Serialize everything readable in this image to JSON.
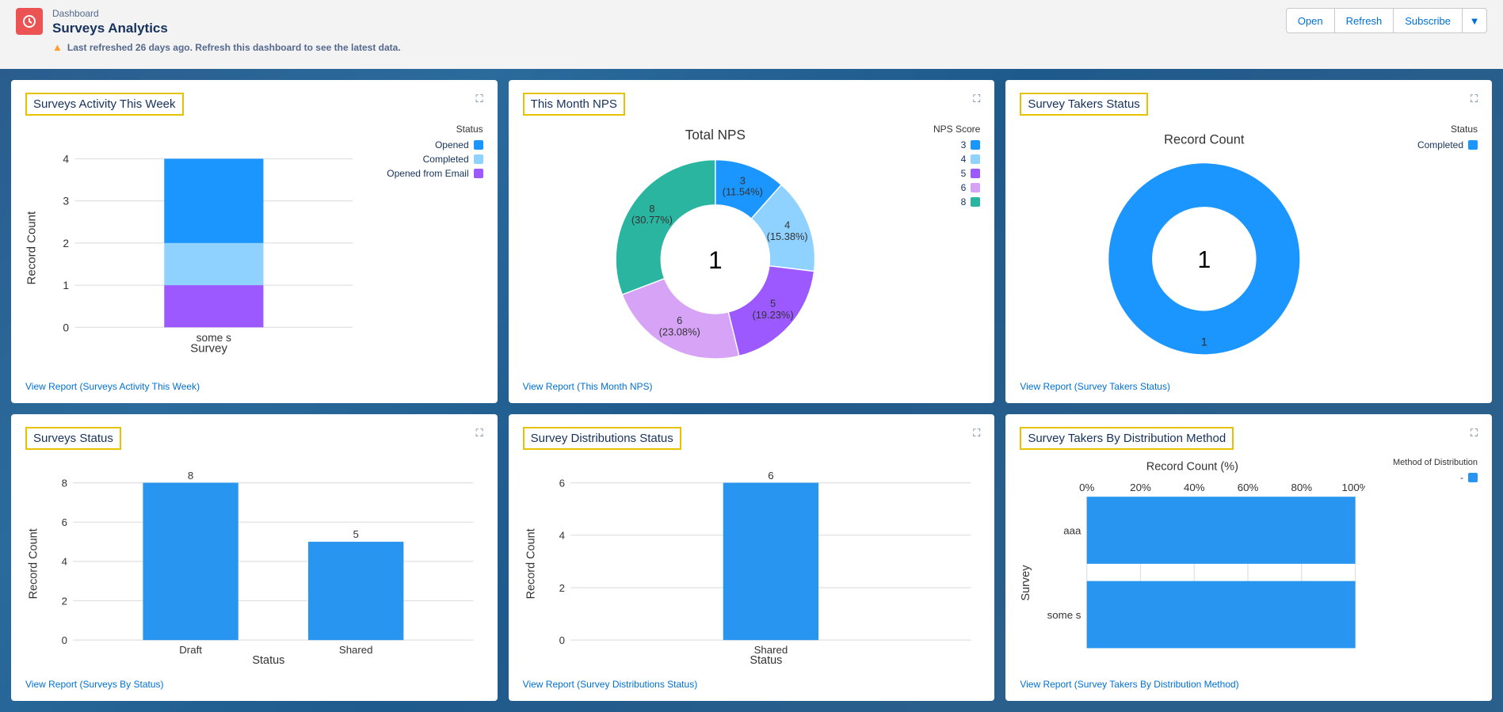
{
  "header": {
    "breadcrumb": "Dashboard",
    "title": "Surveys Analytics",
    "warning": "Last refreshed 26 days ago. Refresh this dashboard to see the latest data.",
    "actions": {
      "open": "Open",
      "refresh": "Refresh",
      "subscribe": "Subscribe"
    }
  },
  "cards": {
    "activity": {
      "title": "Surveys Activity This Week",
      "report_link": "View Report (Surveys Activity This Week)",
      "legend_title": "Status",
      "chart_xlabel": "Survey",
      "chart_ylabel": "Record Count"
    },
    "nps": {
      "title": "This Month NPS",
      "report_link": "View Report (This Month NPS)",
      "center_title": "Total NPS",
      "center_value": "1",
      "legend_title": "NPS Score"
    },
    "takers_status": {
      "title": "Survey Takers Status",
      "report_link": "View Report (Survey Takers Status)",
      "center_title": "Record Count",
      "center_value": "1",
      "legend_title": "Status",
      "outer_label": "1"
    },
    "surveys_status": {
      "title": "Surveys Status",
      "report_link": "View Report (Surveys By Status)",
      "chart_xlabel": "Status",
      "chart_ylabel": "Record Count"
    },
    "dist_status": {
      "title": "Survey Distributions Status",
      "report_link": "View Report (Survey Distributions Status)",
      "chart_xlabel": "Status",
      "chart_ylabel": "Record Count"
    },
    "takers_dist": {
      "title": "Survey Takers By Distribution Method",
      "report_link": "View Report (Survey Takers By Distribution Method)",
      "chart_xlabel": "Record Count (%)",
      "chart_ylabel": "Survey",
      "legend_title": "Method of Distribution"
    }
  },
  "chart_data": [
    {
      "id": "activity",
      "type": "bar",
      "stacked": true,
      "categories": [
        "some s"
      ],
      "series": [
        {
          "name": "Opened",
          "color": "#1b96ff",
          "values": [
            2
          ]
        },
        {
          "name": "Completed",
          "color": "#8fd2ff",
          "values": [
            1
          ]
        },
        {
          "name": "Opened from Email",
          "color": "#9b59ff",
          "values": [
            1
          ]
        }
      ],
      "ylim": [
        0,
        4
      ],
      "ticks": [
        0,
        1,
        2,
        3,
        4
      ],
      "xlabel": "Survey",
      "ylabel": "Record Count"
    },
    {
      "id": "nps",
      "type": "pie",
      "title": "Total NPS",
      "center": "1",
      "slices": [
        {
          "name": "3",
          "value": 3,
          "pct": "11.54%",
          "color": "#1b96ff"
        },
        {
          "name": "4",
          "value": 4,
          "pct": "15.38%",
          "color": "#8fd2ff"
        },
        {
          "name": "5",
          "value": 5,
          "pct": "19.23%",
          "color": "#9b59ff"
        },
        {
          "name": "6",
          "value": 6,
          "pct": "23.08%",
          "color": "#d6a3f7"
        },
        {
          "name": "8",
          "value": 8,
          "pct": "30.77%",
          "color": "#2ab5a0"
        }
      ]
    },
    {
      "id": "takers_status",
      "type": "pie",
      "title": "Record Count",
      "center": "1",
      "slices": [
        {
          "name": "Completed",
          "value": 1,
          "color": "#1b96ff"
        }
      ]
    },
    {
      "id": "surveys_status",
      "type": "bar",
      "categories": [
        "Draft",
        "Shared"
      ],
      "series": [
        {
          "name": "count",
          "color": "#2896f0",
          "values": [
            8,
            5
          ]
        }
      ],
      "ylim": [
        0,
        8
      ],
      "ticks": [
        0,
        2,
        4,
        6,
        8
      ],
      "xlabel": "Status",
      "ylabel": "Record Count"
    },
    {
      "id": "dist_status",
      "type": "bar",
      "categories": [
        "Shared"
      ],
      "series": [
        {
          "name": "count",
          "color": "#2896f0",
          "values": [
            6
          ]
        }
      ],
      "ylim": [
        0,
        6
      ],
      "ticks": [
        0,
        2,
        4,
        6
      ],
      "xlabel": "Status",
      "ylabel": "Record Count"
    },
    {
      "id": "takers_dist",
      "type": "bar",
      "orientation": "horizontal",
      "categories": [
        "aaa",
        "some s"
      ],
      "series": [
        {
          "name": "-",
          "color": "#2896f0",
          "values": [
            100,
            100
          ]
        }
      ],
      "xlim": [
        0,
        100
      ],
      "ticks": [
        0,
        20,
        40,
        60,
        80,
        100
      ],
      "xlabel": "Record Count (%)",
      "ylabel": "Survey"
    }
  ]
}
